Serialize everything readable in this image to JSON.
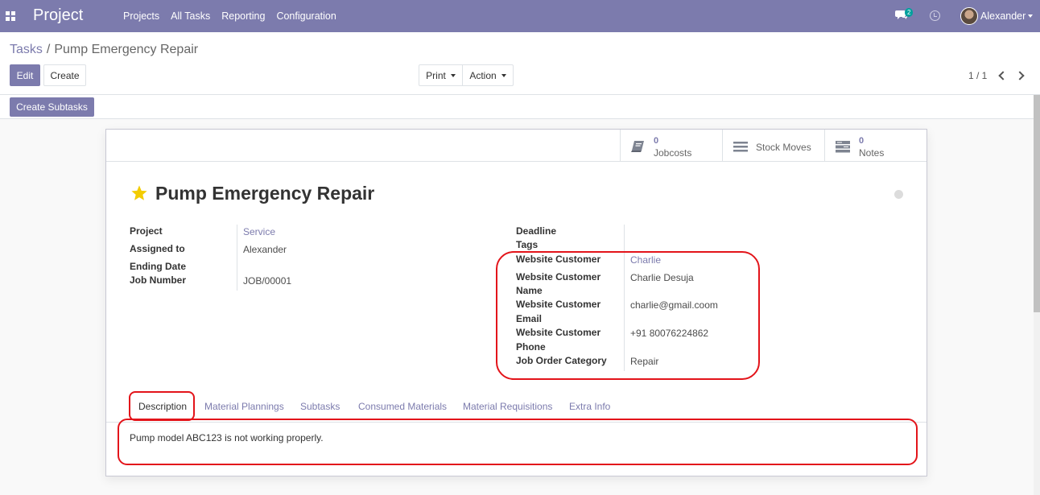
{
  "nav": {
    "brand": "Project",
    "menu": [
      "Projects",
      "All Tasks",
      "Reporting",
      "Configuration"
    ],
    "chat_count": "2",
    "user_name": "Alexander"
  },
  "control": {
    "breadcrumb_parent": "Tasks",
    "breadcrumb_sep": "/",
    "breadcrumb_current": "Pump Emergency Repair",
    "edit_label": "Edit",
    "create_label": "Create",
    "print_label": "Print",
    "action_label": "Action",
    "pager": "1 / 1"
  },
  "status_bar": {
    "create_subtasks_label": "Create Subtasks"
  },
  "smart_buttons": {
    "jobcosts_value": "0",
    "jobcosts_label": "Jobcosts",
    "stock_moves_label": "Stock Moves",
    "notes_value": "0",
    "notes_label": "Notes"
  },
  "task": {
    "title": "Pump Emergency Repair",
    "left": {
      "project_label": "Project",
      "project_value": "Service",
      "assigned_label": "Assigned to",
      "assigned_value": "Alexander",
      "ending_label": "Ending Date",
      "job_label": "Job Number",
      "job_value": "JOB/00001"
    },
    "right": {
      "deadline_label": "Deadline",
      "tags_label": "Tags",
      "website_customer_label": "Website Customer",
      "website_customer_value": "Charlie",
      "customer_name_label_1": "Website Customer",
      "customer_name_label_2": "Name",
      "customer_name_value": "Charlie Desuja",
      "customer_email_label_1": "Website Customer",
      "customer_email_label_2": "Email",
      "customer_email_value": "charlie@gmail.coom",
      "customer_phone_label_1": "Website Customer",
      "customer_phone_label_2": "Phone",
      "customer_phone_value": "+91 80076224862",
      "job_category_label": "Job Order Category",
      "job_category_value": "Repair"
    }
  },
  "tabs": [
    "Description",
    "Material Plannings",
    "Subtasks",
    "Consumed Materials",
    "Material Requisitions",
    "Extra Info"
  ],
  "description": "Pump model ABC123 is not working properly.",
  "colors": {
    "navbar": "#7c7bad",
    "accent": "#7c7bad",
    "star": "#f3cc00",
    "annotation": "#e3141a"
  }
}
